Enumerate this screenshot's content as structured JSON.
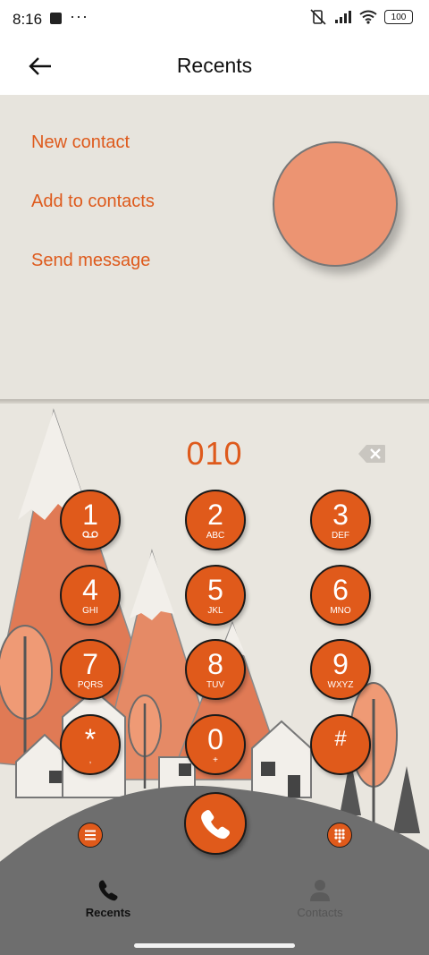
{
  "status": {
    "time": "8:16",
    "dots": "···",
    "battery": "100"
  },
  "header": {
    "title": "Recents",
    "back_icon": "back-arrow-icon"
  },
  "actions": {
    "new_contact": "New contact",
    "add_to_contacts": "Add to contacts",
    "send_message": "Send message"
  },
  "dialer": {
    "number": "010",
    "keys": [
      {
        "digit": "1",
        "letters": "voicemail-icon"
      },
      {
        "digit": "2",
        "letters": "ABC"
      },
      {
        "digit": "3",
        "letters": "DEF"
      },
      {
        "digit": "4",
        "letters": "GHI"
      },
      {
        "digit": "5",
        "letters": "JKL"
      },
      {
        "digit": "6",
        "letters": "MNO"
      },
      {
        "digit": "7",
        "letters": "PQRS"
      },
      {
        "digit": "8",
        "letters": "TUV"
      },
      {
        "digit": "9",
        "letters": "WXYZ"
      },
      {
        "digit": "*",
        "letters": ","
      },
      {
        "digit": "0",
        "letters": "+"
      },
      {
        "digit": "#",
        "letters": ""
      }
    ]
  },
  "nav": {
    "recents": "Recents",
    "contacts": "Contacts"
  },
  "colors": {
    "accent": "#de5a1c",
    "key": "#e05a1b",
    "mountain": "#e07a55",
    "ground": "#6e6e6e"
  }
}
